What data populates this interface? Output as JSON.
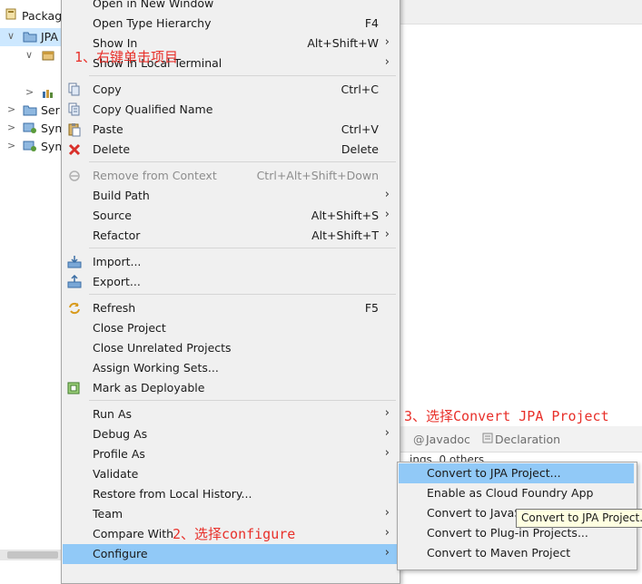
{
  "explorer": {
    "title": "Packag",
    "items": [
      {
        "label": "JPA",
        "arrow": "∨",
        "icon": "project-folder-icon",
        "selected": true
      },
      {
        "label": "",
        "arrow": "∨",
        "icon": "package-icon"
      },
      {
        "label": "",
        "arrow": ">",
        "icon": "library-icon"
      },
      {
        "label": "Ser",
        "arrow": ">",
        "icon": "folder-icon"
      },
      {
        "label": "Syn",
        "arrow": ">",
        "icon": "sync-project-icon"
      },
      {
        "label": "Syn",
        "arrow": ">",
        "icon": "sync-project-icon"
      }
    ]
  },
  "bottom_panel": {
    "tabs": [
      {
        "label": "Javadoc",
        "icon": "javadoc-icon"
      },
      {
        "label": "Declaration",
        "icon": "declaration-icon"
      }
    ],
    "status": "ings, 0 others"
  },
  "context_menu": {
    "items": [
      {
        "label": "Open in New Window",
        "accel": ""
      },
      {
        "label": "Open Type Hierarchy",
        "accel": "F4"
      },
      {
        "label": "Show In",
        "accel": "Alt+Shift+W",
        "submenu": true
      },
      {
        "label": "Show in Local Terminal",
        "accel": "",
        "submenu": true
      },
      {
        "label": "Copy",
        "accel": "Ctrl+C",
        "icon": "copy-icon"
      },
      {
        "label": "Copy Qualified Name",
        "accel": "",
        "icon": "copy-qualified-name-icon"
      },
      {
        "label": "Paste",
        "accel": "Ctrl+V",
        "icon": "paste-icon"
      },
      {
        "label": "Delete",
        "accel": "Delete",
        "icon": "delete-icon"
      },
      {
        "label": "Remove from Context",
        "accel": "Ctrl+Alt+Shift+Down",
        "icon": "remove-context-icon",
        "disabled": true
      },
      {
        "label": "Build Path",
        "accel": "",
        "submenu": true
      },
      {
        "label": "Source",
        "accel": "Alt+Shift+S",
        "submenu": true
      },
      {
        "label": "Refactor",
        "accel": "Alt+Shift+T",
        "submenu": true
      },
      {
        "label": "Import...",
        "accel": "",
        "icon": "import-icon"
      },
      {
        "label": "Export...",
        "accel": "",
        "icon": "export-icon"
      },
      {
        "label": "Refresh",
        "accel": "F5",
        "icon": "refresh-icon"
      },
      {
        "label": "Close Project",
        "accel": ""
      },
      {
        "label": "Close Unrelated Projects",
        "accel": ""
      },
      {
        "label": "Assign Working Sets...",
        "accel": ""
      },
      {
        "label": "Mark as Deployable",
        "accel": "",
        "icon": "deployable-icon"
      },
      {
        "label": "Run As",
        "accel": "",
        "submenu": true
      },
      {
        "label": "Debug As",
        "accel": "",
        "submenu": true
      },
      {
        "label": "Profile As",
        "accel": "",
        "submenu": true
      },
      {
        "label": "Validate",
        "accel": ""
      },
      {
        "label": "Restore from Local History...",
        "accel": ""
      },
      {
        "label": "Team",
        "accel": "",
        "submenu": true
      },
      {
        "label": "Compare With",
        "accel": "",
        "submenu": true
      },
      {
        "label": "Configure",
        "accel": "",
        "submenu": true,
        "highlighted": true
      }
    ]
  },
  "configure_submenu": {
    "items": [
      {
        "label": "Convert to JPA Project...",
        "highlighted": true
      },
      {
        "label": "Enable as Cloud Foundry App"
      },
      {
        "label": "Convert to JavaS"
      },
      {
        "label": "Convert to Plug-in Projects..."
      },
      {
        "label": "Convert to Maven Project"
      }
    ]
  },
  "tooltip": "Convert to JPA Project.",
  "annotations": {
    "step1": "1、右键单击项目",
    "step2": "2、选择configure",
    "step3": "3、选择Convert JPA Project"
  },
  "colors": {
    "menu_bg": "#f0f0f0",
    "highlight": "#91c9f7",
    "annotation": "#e8302a",
    "tooltip_bg": "#ffffe1"
  }
}
